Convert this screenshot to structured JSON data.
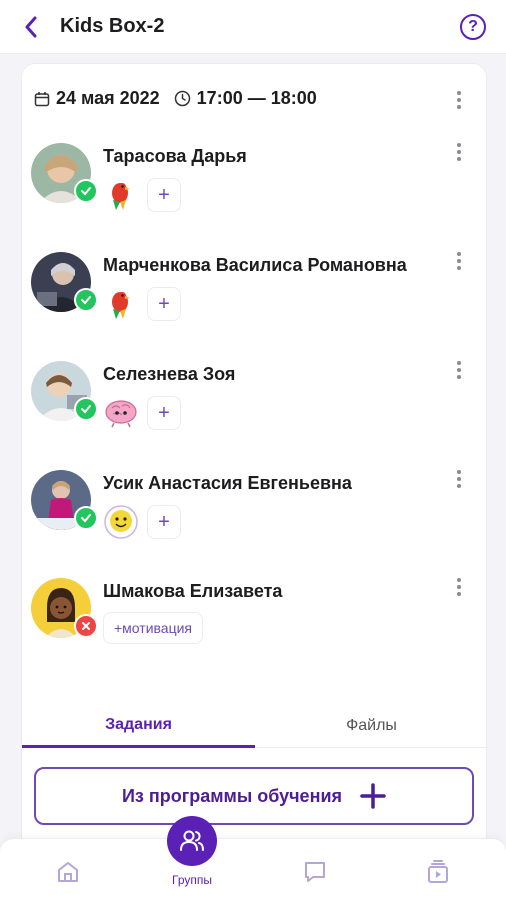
{
  "header": {
    "title": "Kids Box-2",
    "back_icon": "chevron-left-icon",
    "help_icon": "question-circle-icon",
    "help_glyph": "?"
  },
  "lesson": {
    "date": "24 мая 2022",
    "time": "17:00 — 18:00",
    "date_icon": "calendar-icon",
    "time_icon": "clock-icon"
  },
  "students": [
    {
      "name": "Тарасова Дарья",
      "present": true,
      "sticker": "parrot-sticker-icon",
      "action": "+"
    },
    {
      "name": "Марченкова Василиса Романовна",
      "present": true,
      "sticker": "parrot-sticker-icon",
      "action": "+"
    },
    {
      "name": "Селезнева Зоя",
      "present": true,
      "sticker": "brain-sticker-icon",
      "action": "+"
    },
    {
      "name": "Усик Анастасия Евгеньевна",
      "present": true,
      "sticker": "smiley-sticker-icon",
      "action": "+"
    },
    {
      "name": "Шмакова Елизавета",
      "present": false,
      "sticker": null,
      "action": "+мотивация"
    }
  ],
  "tabs": [
    {
      "label": "Задания",
      "active": true
    },
    {
      "label": "Файлы",
      "active": false
    }
  ],
  "program_button": {
    "label": "Из программы обучения",
    "icon": "plus-icon"
  },
  "bottom_nav": {
    "items": [
      {
        "icon": "home-icon"
      },
      {
        "icon": "users-icon",
        "label": "Группы",
        "active": true
      },
      {
        "icon": "chat-icon"
      },
      {
        "icon": "video-library-icon"
      }
    ]
  },
  "colors": {
    "accent": "#5b21b6",
    "present": "#22c55e",
    "absent": "#ef4444"
  }
}
